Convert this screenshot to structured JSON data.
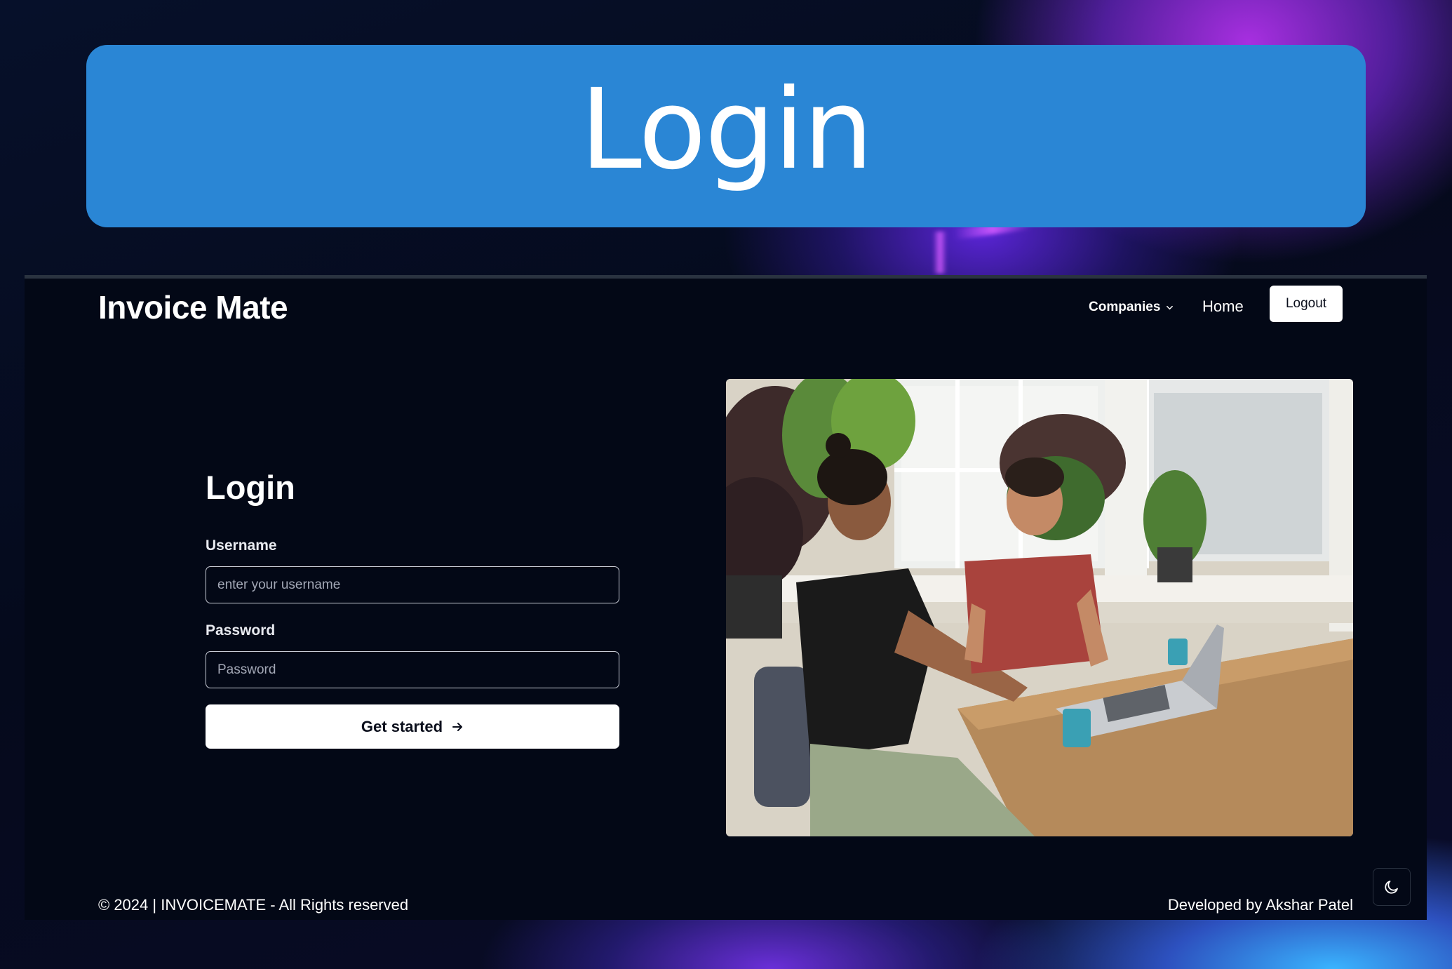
{
  "banner": {
    "title": "Login"
  },
  "navbar": {
    "brand": "Invoice Mate",
    "companies_label": "Companies",
    "home_label": "Home",
    "logout_label": "Logout"
  },
  "login_form": {
    "heading": "Login",
    "username_label": "Username",
    "username_placeholder": "enter your username",
    "username_value": "",
    "password_label": "Password",
    "password_placeholder": "Password",
    "password_value": "",
    "submit_label": "Get started"
  },
  "hero_image": {
    "alt": "Two men working at a laptop on a wooden table"
  },
  "footer": {
    "copyright": "© 2024 | INVOICEMATE - All Rights reserved",
    "credit": "Developed by Akshar Patel"
  },
  "icons": {
    "companies_dropdown": "chevron-down-icon",
    "submit_arrow": "arrow-right-icon",
    "theme_toggle": "moon-icon"
  },
  "colors": {
    "banner_bg": "#2a86d5",
    "app_bg": "#030816",
    "button_bg": "#ffffff",
    "text_primary": "#ffffff"
  }
}
